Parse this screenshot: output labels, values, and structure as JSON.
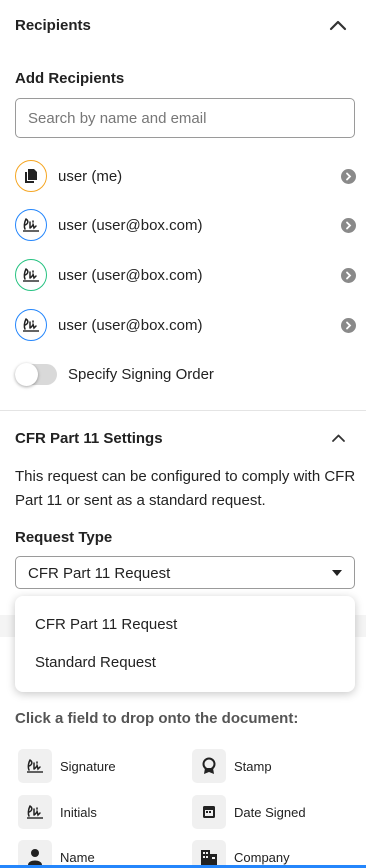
{
  "recipients_section": {
    "title": "Recipients",
    "add_label": "Add Recipients",
    "search_placeholder": "Search by name and email",
    "items": [
      {
        "name": "user (me)",
        "role": "copy",
        "color": "#f5a623"
      },
      {
        "name": "user (user@box.com)",
        "role": "signer",
        "color": "#2486fc"
      },
      {
        "name": "user (user@box.com)",
        "role": "signer",
        "color": "#26c281"
      },
      {
        "name": "user (user@box.com)",
        "role": "signer",
        "color": "#2486fc"
      }
    ],
    "signing_order_label": "Specify Signing Order",
    "signing_order_enabled": false
  },
  "cfr_section": {
    "title": "CFR Part 11 Settings",
    "description": "This request can be configured to comply with CFR Part 11 or sent as a standard request.",
    "request_type_label": "Request Type",
    "request_type_value": "CFR Part 11 Request",
    "options": [
      "CFR Part 11 Request",
      "Standard Request"
    ]
  },
  "fields_section": {
    "hint": "Click a field to drop onto the document:",
    "fields": [
      {
        "label": "Signature",
        "icon": "signature-icon"
      },
      {
        "label": "Stamp",
        "icon": "stamp-icon"
      },
      {
        "label": "Initials",
        "icon": "initials-icon"
      },
      {
        "label": "Date Signed",
        "icon": "calendar-icon"
      },
      {
        "label": "Name",
        "icon": "person-icon"
      },
      {
        "label": "Company",
        "icon": "building-icon"
      }
    ]
  },
  "colors": {
    "accent": "#2486fc",
    "text": "#222222"
  }
}
